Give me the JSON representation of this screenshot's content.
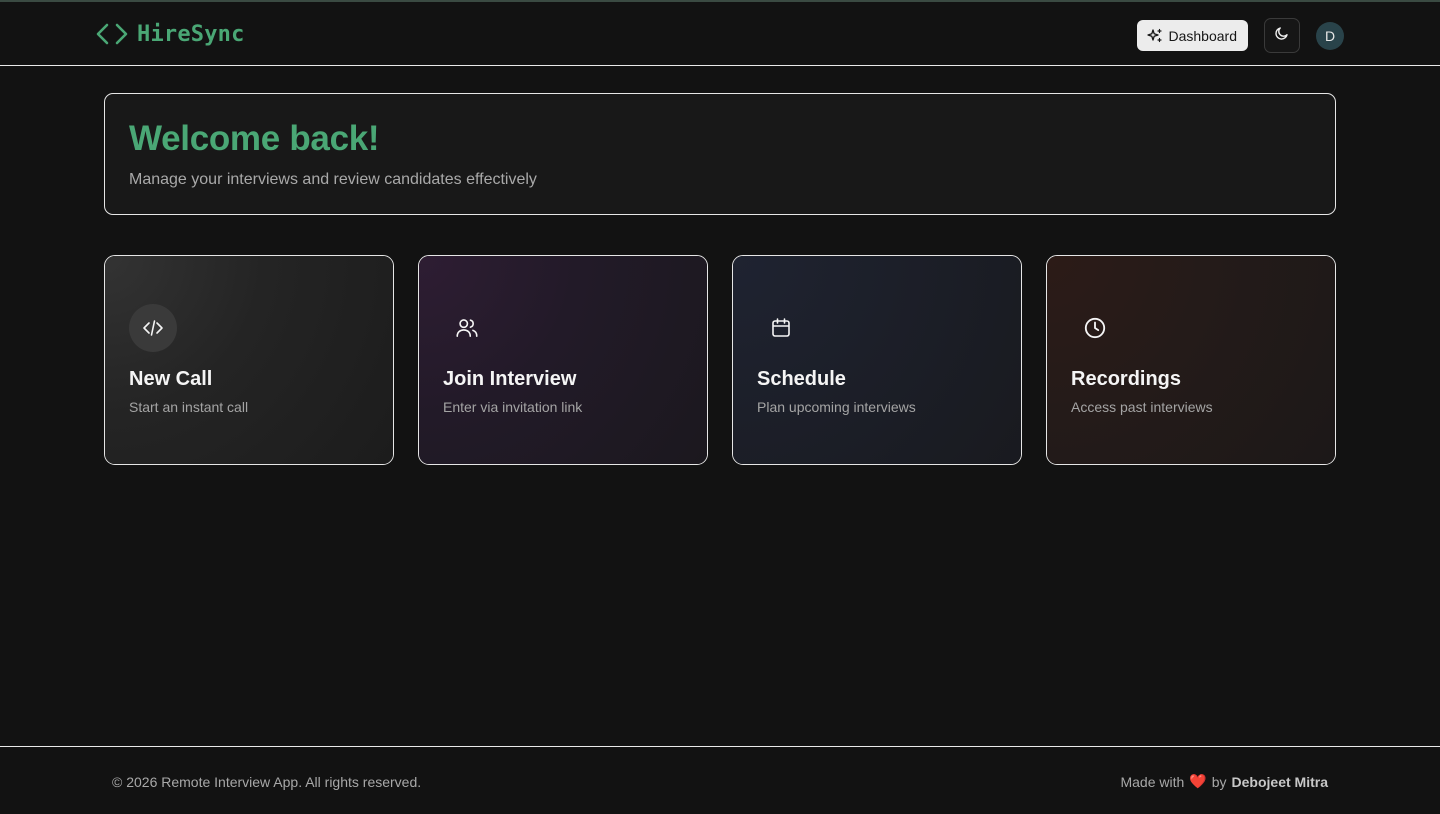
{
  "header": {
    "brand": "HireSync",
    "brand_icon": "code-brackets-icon",
    "dashboard_label": "Dashboard",
    "dashboard_icon": "sparkles-icon",
    "theme_icon": "moon-icon",
    "avatar_initial": "D"
  },
  "welcome": {
    "title": "Welcome back!",
    "subtitle": "Manage your interviews and review candidates effectively"
  },
  "cards": [
    {
      "title": "New Call",
      "subtitle": "Start an instant call",
      "icon": "code-icon",
      "accent": "#3a3a3a"
    },
    {
      "title": "Join Interview",
      "subtitle": "Enter via invitation link",
      "icon": "users-icon",
      "accent": "#2a1a2e"
    },
    {
      "title": "Schedule",
      "subtitle": "Plan upcoming interviews",
      "icon": "calendar-icon",
      "accent": "#1b2030"
    },
    {
      "title": "Recordings",
      "subtitle": "Access past interviews",
      "icon": "clock-icon",
      "accent": "#2b1a16"
    }
  ],
  "footer": {
    "copyright": "© 2026 Remote Interview App. All rights reserved.",
    "made_with": "Made with",
    "heart": "❤️",
    "by": "by",
    "author": "Debojeet Mitra"
  },
  "colors": {
    "brand_green": "#4aa775",
    "background": "#121212"
  }
}
